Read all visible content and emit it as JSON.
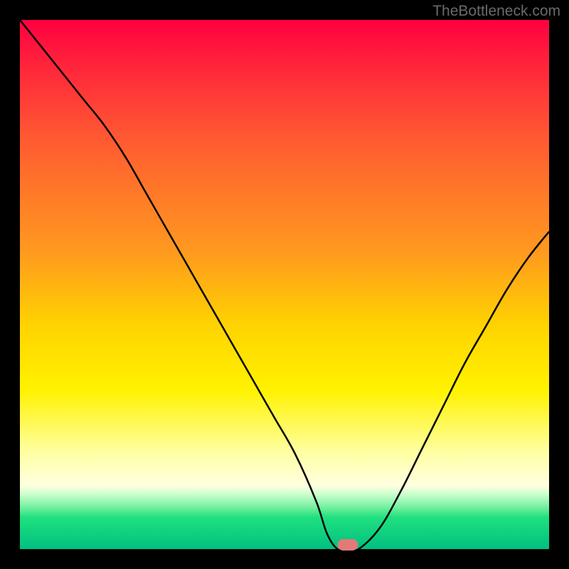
{
  "watermark": "TheBottleneck.com",
  "chart_data": {
    "type": "line",
    "title": "",
    "xlabel": "",
    "ylabel": "",
    "xlim": [
      0,
      100
    ],
    "ylim": [
      0,
      100
    ],
    "x": [
      0,
      4,
      8,
      12,
      16,
      20,
      24,
      28,
      32,
      36,
      40,
      44,
      48,
      52,
      56,
      58,
      60,
      62,
      64,
      68,
      72,
      76,
      80,
      84,
      88,
      92,
      96,
      100
    ],
    "values": [
      100,
      95,
      90,
      85,
      80,
      74,
      67,
      60,
      53,
      46,
      39,
      32,
      25,
      18,
      9,
      3,
      0,
      0,
      0,
      4,
      11,
      19,
      27,
      35,
      42,
      49,
      55,
      60
    ],
    "marker": {
      "x": 62,
      "y": 0
    },
    "annotations": []
  },
  "colors": {
    "curve": "#000000",
    "marker": "#e27a7a"
  }
}
